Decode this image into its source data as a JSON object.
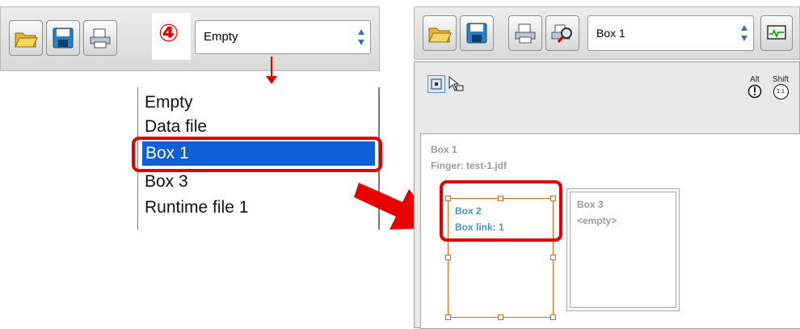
{
  "left_toolbar": {
    "step_marker": "④",
    "combo_value": "Empty"
  },
  "dropdown": {
    "items": [
      {
        "label": "Empty",
        "selected": false
      },
      {
        "label": "Data file",
        "selected": false
      },
      {
        "label": "Box 1",
        "selected": true
      },
      {
        "label": "Box 3",
        "selected": false
      },
      {
        "label": "Runtime file 1",
        "selected": false
      }
    ]
  },
  "right_toolbar": {
    "combo_value": "Box 1"
  },
  "panel": {
    "alt_label": "Alt",
    "shift_label": "Shift",
    "shift_symbol": "1:1"
  },
  "canvas": {
    "box1_name": "Box 1",
    "box1_finger": "Finger: test-1.jdf",
    "box2_name": "Box 2",
    "box2_link": "Box link: 1",
    "box3_name": "Box 3",
    "box3_content": "<empty>"
  },
  "colors": {
    "accent_red": "#e00000",
    "selection_blue": "#0f5fd6",
    "box_orange": "#d2691e",
    "box_text_blue": "#4a90cf"
  },
  "icons": [
    "open-folder-icon",
    "save-disk-icon",
    "print-icon",
    "print-preview-icon",
    "monitor-icon",
    "selection-tool-icon",
    "pointer-tool-icon",
    "alt-info-icon",
    "shift-scale-icon",
    "arrow-down-icon",
    "arrow-right-icon"
  ]
}
